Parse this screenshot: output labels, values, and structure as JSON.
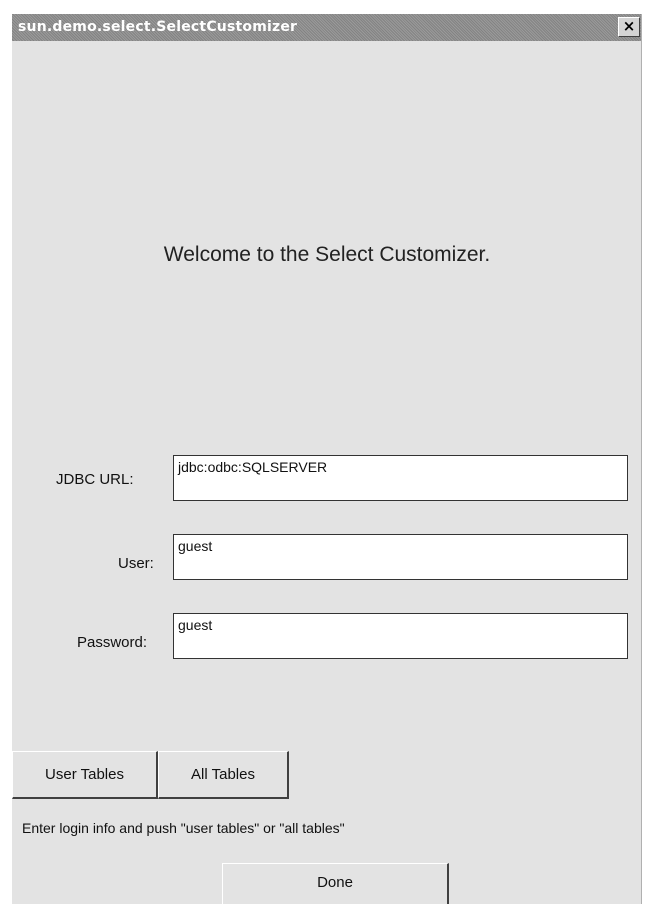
{
  "window": {
    "title": "sun.demo.select.SelectCustomizer",
    "close_label": "×"
  },
  "welcome_text": "Welcome to the Select Customizer.",
  "form": {
    "jdbc_url": {
      "label": "JDBC URL:",
      "value": "jdbc:odbc:SQLSERVER"
    },
    "user": {
      "label": "User:",
      "value": "guest"
    },
    "password": {
      "label": "Password:",
      "value": "guest"
    }
  },
  "buttons": {
    "user_tables": "User Tables",
    "all_tables": "All Tables",
    "done": "Done"
  },
  "status_text": "Enter login info and push \"user tables\" or \"all tables\""
}
